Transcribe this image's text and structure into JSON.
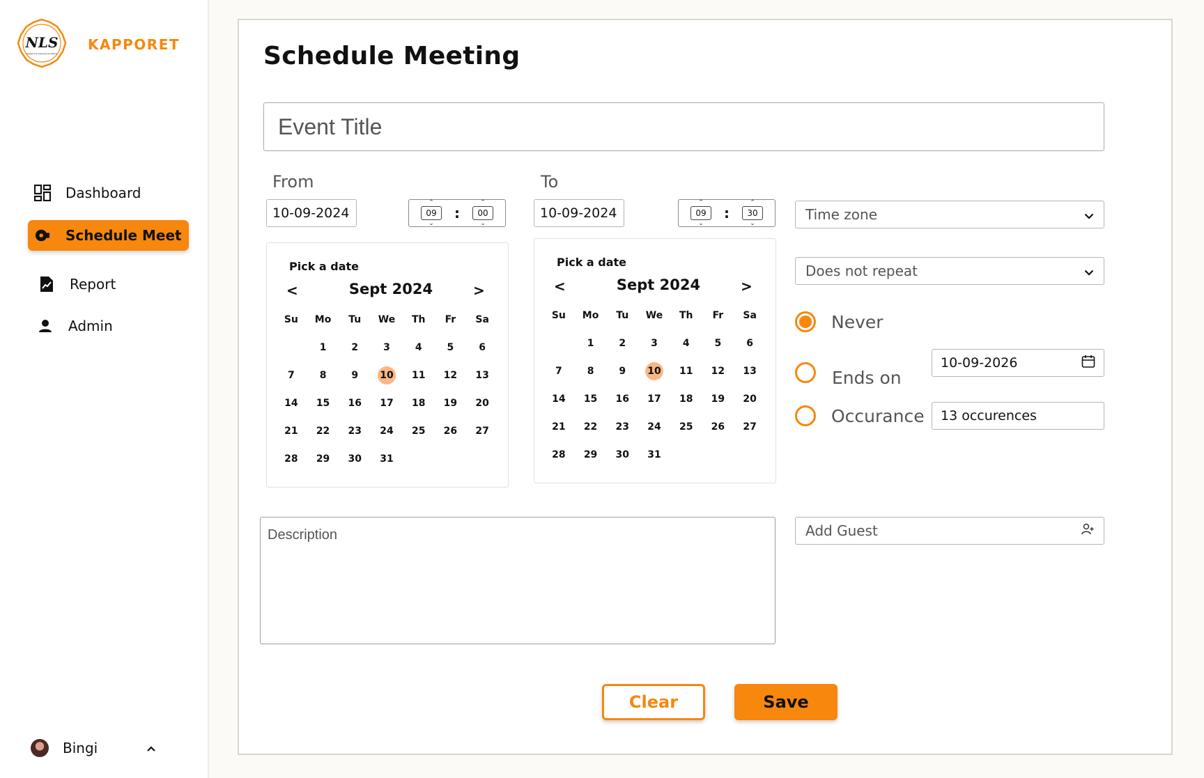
{
  "brand": {
    "name": "KAPPORET",
    "logo_letters": "NLS",
    "logo_tagline": "Support & Learning Solutions",
    "accent": "#f7870d"
  },
  "sidebar": {
    "items": [
      {
        "label": "Dashboard",
        "icon": "dashboard-icon",
        "active": false
      },
      {
        "label": "Schedule Meet",
        "icon": "video-camera-icon",
        "active": true
      },
      {
        "label": "Report",
        "icon": "report-icon",
        "active": false
      },
      {
        "label": "Admin",
        "icon": "person-icon",
        "active": false
      }
    ],
    "user": {
      "name": "Bingi"
    }
  },
  "page": {
    "title": "Schedule Meeting"
  },
  "form": {
    "event_title_placeholder": "Event Title",
    "from": {
      "label": "From",
      "date": "10-09-2024",
      "hour": "09",
      "minute": "00"
    },
    "to": {
      "label": "To",
      "date": "10-09-2024",
      "hour": "09",
      "minute": "30"
    },
    "timezone_placeholder": "Time zone",
    "repeat_value": "Does not repeat",
    "end_options": {
      "never": "Never",
      "ends_on": "Ends on",
      "ends_on_date": "10-09-2026",
      "occurrence": "Occurance",
      "occurrence_value": "13 occurences",
      "selected": "never"
    },
    "description_placeholder": "Description",
    "guest_placeholder": "Add Guest",
    "clear_label": "Clear",
    "save_label": "Save"
  },
  "calendar": {
    "title": "Pick a date",
    "month": "Sept 2024",
    "prev": "<",
    "next": ">",
    "weekdays": [
      "Su",
      "Mo",
      "Tu",
      "We",
      "Th",
      "Fr",
      "Sa"
    ],
    "weeks": [
      [
        "",
        "1",
        "2",
        "3",
        "4",
        "5",
        "6"
      ],
      [
        "7",
        "8",
        "9",
        "10",
        "11",
        "12",
        "13"
      ],
      [
        "14",
        "15",
        "16",
        "17",
        "18",
        "19",
        "20"
      ],
      [
        "21",
        "22",
        "23",
        "24",
        "25",
        "26",
        "27"
      ],
      [
        "28",
        "29",
        "30",
        "31",
        "",
        "",
        ""
      ]
    ],
    "selected_day": "10"
  }
}
